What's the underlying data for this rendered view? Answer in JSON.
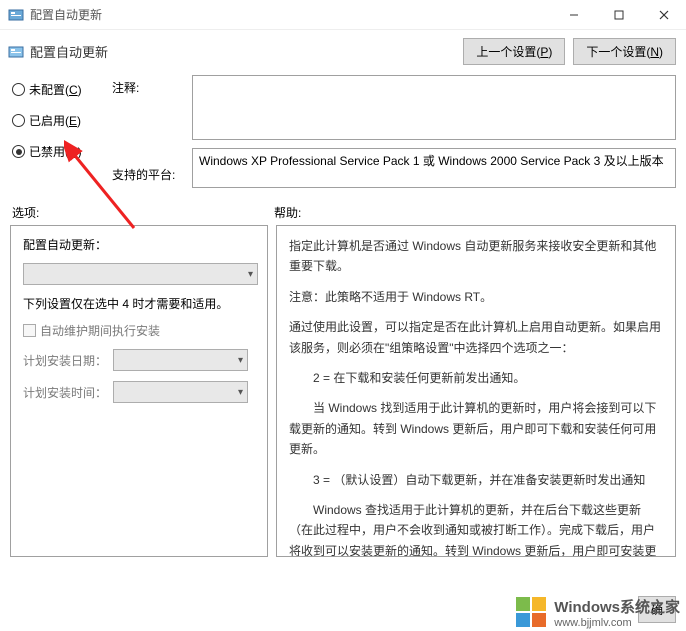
{
  "window": {
    "title": "配置自动更新"
  },
  "header": {
    "title": "配置自动更新",
    "prev_button": "上一个设置(",
    "prev_key": "P",
    "next_button": "下一个设置(",
    "next_key": "N",
    "btn_close_paren": ")"
  },
  "radios": {
    "not_configured": "未配置(",
    "not_configured_key": "C",
    "enabled": "已启用(",
    "enabled_key": "E",
    "disabled": "已禁用(",
    "disabled_key": "D",
    "close_paren": ")"
  },
  "labels": {
    "comment": "注释:",
    "supported_platforms": "支持的平台:",
    "options": "选项:",
    "help": "帮助:"
  },
  "platform_text": "Windows XP Professional Service Pack 1 或 Windows 2000 Service Pack 3 及以上版本",
  "options_pane": {
    "title": "配置自动更新：",
    "note": "下列设置仅在选中 4 时才需要和适用。",
    "checkbox_label": "自动维护期间执行安装",
    "install_date_label": "计划安装日期：",
    "install_time_label": "计划安装时间："
  },
  "help_pane": {
    "p1": "指定此计算机是否通过 Windows 自动更新服务来接收安全更新和其他重要下载。",
    "p2": "注意：此策略不适用于 Windows RT。",
    "p3": "通过使用此设置，可以指定是否在此计算机上启用自动更新。如果启用该服务，则必须在\"组策略设置\"中选择四个选项之一：",
    "p4": "2 = 在下载和安装任何更新前发出通知。",
    "p5": "当 Windows 找到适用于此计算机的更新时，用户将会接到可以下载更新的通知。转到 Windows 更新后，用户即可下载和安装任何可用更新。",
    "p6": "3 = （默认设置）自动下载更新，并在准备安装更新时发出通知",
    "p7": "Windows 查找适用于此计算机的更新，并在后台下载这些更新（在此过程中，用户不会收到通知或被打断工作）。完成下载后，用户将收到可以安装更新的通知。转到 Windows 更新后，用户即可安装更新。"
  },
  "footer": {
    "ok_partial": "确"
  },
  "watermark": {
    "text": "Windows系统之家",
    "link": "www.bjjmlv.com"
  }
}
